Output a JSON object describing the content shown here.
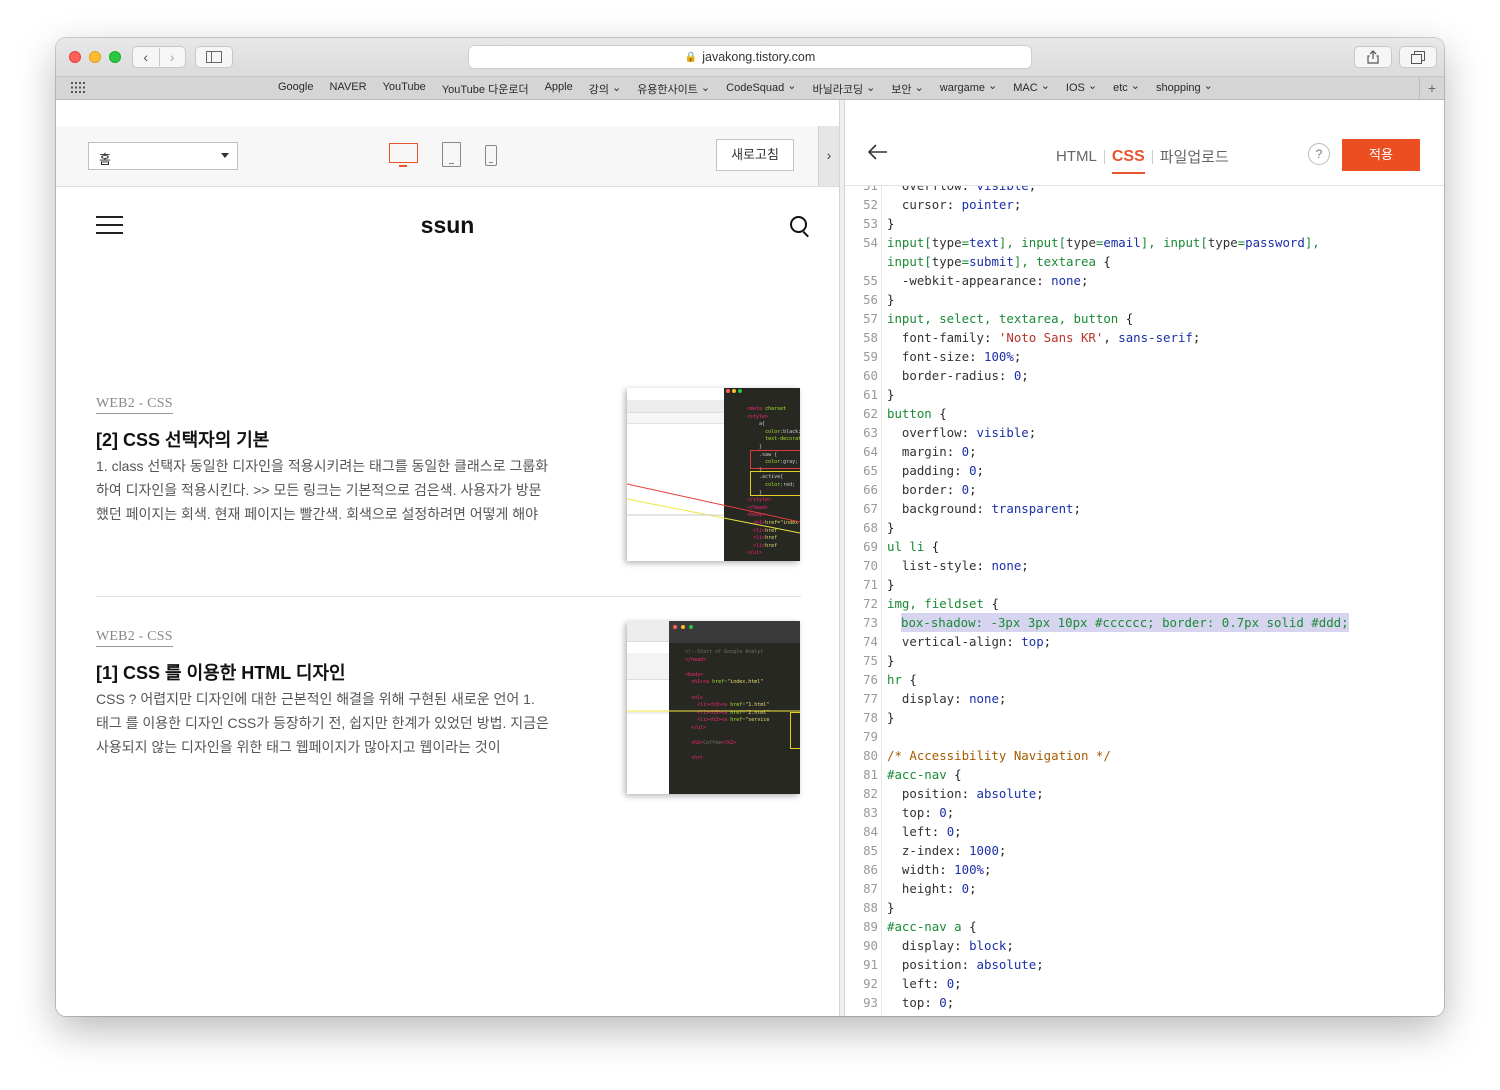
{
  "browser": {
    "url": "javakong.tistory.com",
    "bookmarks": [
      "Google",
      "NAVER",
      "YouTube",
      "YouTube 다운로더",
      "Apple",
      "강의",
      "유용한사이트",
      "CodeSquad",
      "바닐라코딩",
      "보안",
      "wargame",
      "MAC",
      "IOS",
      "etc",
      "shopping"
    ],
    "bookmark_dropdowns": [
      "강의",
      "유용한사이트",
      "CodeSquad",
      "바닐라코딩",
      "보안",
      "wargame",
      "MAC",
      "IOS",
      "etc",
      "shopping"
    ]
  },
  "preview": {
    "page_select": "홈",
    "refresh_label": "새로고침",
    "blog_title": "ssun",
    "posts": [
      {
        "category": "WEB2 - CSS",
        "title": "[2] CSS 선택자의 기본",
        "excerpt": "1. class 선택자 동일한 디자인을 적용시키려는 태그를 동일한 클래스로 그룹화 하여 디자인을 적용시킨다. >> 모든 링크는 기본적으로 검은색. 사용자가 방문했던 페이지는 회색. 현재 페이지는 빨간색. 회색으로 설정하려면 어떻게 해야 할까"
      },
      {
        "category": "WEB2 - CSS",
        "title": "[1] CSS 를 이용한 HTML 디자인",
        "excerpt": "CSS ? 어렵지만 디자인에 대한 근본적인 해결을 위해 구현된 새로운 언어 1. 태그 를 이용한 디자인 CSS가 등장하기 전, 쉽지만 한계가 있었던 방법. 지금은 사용되지 않는 디자인을 위한 태그 웹페이지가 많아지고 웹이라는 것이"
      }
    ]
  },
  "editor": {
    "tabs": [
      "HTML",
      "CSS",
      "파일업로드"
    ],
    "active_tab": "CSS",
    "help_label": "?",
    "apply_label": "적용",
    "code": [
      {
        "n": "51",
        "t": "  overflow: visible;"
      },
      {
        "n": "52",
        "t": "  cursor: pointer;"
      },
      {
        "n": "53",
        "t": "}"
      },
      {
        "n": "54",
        "t": "input[type=text], input[type=email], input[type=password],"
      },
      {
        "n": "",
        "t": "input[type=submit], textarea {"
      },
      {
        "n": "55",
        "t": "  -webkit-appearance: none;"
      },
      {
        "n": "56",
        "t": "}"
      },
      {
        "n": "57",
        "t": "input, select, textarea, button {"
      },
      {
        "n": "58",
        "t": "  font-family: 'Noto Sans KR', sans-serif;"
      },
      {
        "n": "59",
        "t": "  font-size: 100%;"
      },
      {
        "n": "60",
        "t": "  border-radius: 0;"
      },
      {
        "n": "61",
        "t": "}"
      },
      {
        "n": "62",
        "t": "button {"
      },
      {
        "n": "63",
        "t": "  overflow: visible;"
      },
      {
        "n": "64",
        "t": "  margin: 0;"
      },
      {
        "n": "65",
        "t": "  padding: 0;"
      },
      {
        "n": "66",
        "t": "  border: 0;"
      },
      {
        "n": "67",
        "t": "  background: transparent;"
      },
      {
        "n": "68",
        "t": "}"
      },
      {
        "n": "69",
        "t": "ul li {"
      },
      {
        "n": "70",
        "t": "  list-style: none;"
      },
      {
        "n": "71",
        "t": "}"
      },
      {
        "n": "72",
        "t": "img, fieldset {"
      },
      {
        "n": "73",
        "t": "  box-shadow: -3px 3px 10px #cccccc; border: 0.7px solid #ddd;",
        "highlight": true
      },
      {
        "n": "74",
        "t": "  vertical-align: top;"
      },
      {
        "n": "75",
        "t": "}"
      },
      {
        "n": "76",
        "t": "hr {"
      },
      {
        "n": "77",
        "t": "  display: none;"
      },
      {
        "n": "78",
        "t": "}"
      },
      {
        "n": "79",
        "t": ""
      },
      {
        "n": "80",
        "t": "/* Accessibility Navigation */"
      },
      {
        "n": "81",
        "t": "#acc-nav {"
      },
      {
        "n": "82",
        "t": "  position: absolute;"
      },
      {
        "n": "83",
        "t": "  top: 0;"
      },
      {
        "n": "84",
        "t": "  left: 0;"
      },
      {
        "n": "85",
        "t": "  z-index: 1000;"
      },
      {
        "n": "86",
        "t": "  width: 100%;"
      },
      {
        "n": "87",
        "t": "  height: 0;"
      },
      {
        "n": "88",
        "t": "}"
      },
      {
        "n": "89",
        "t": "#acc-nav a {"
      },
      {
        "n": "90",
        "t": "  display: block;"
      },
      {
        "n": "91",
        "t": "  position: absolute;"
      },
      {
        "n": "92",
        "t": "  left: 0;"
      },
      {
        "n": "93",
        "t": "  top: 0;"
      }
    ]
  },
  "colors": {
    "accent": "#e8552b",
    "apply_button": "#eb4f21",
    "highlight": "#d7d4f0"
  },
  "icons": [
    "back-icon",
    "forward-icon",
    "sidebar-icon",
    "lock-icon",
    "share-icon",
    "tabs-icon",
    "apps-grid-icon",
    "add-bookmark-icon",
    "desktop-icon",
    "tablet-icon",
    "mobile-icon",
    "collapse-icon",
    "hamburger-icon",
    "search-icon",
    "back-arrow-icon",
    "help-icon"
  ]
}
